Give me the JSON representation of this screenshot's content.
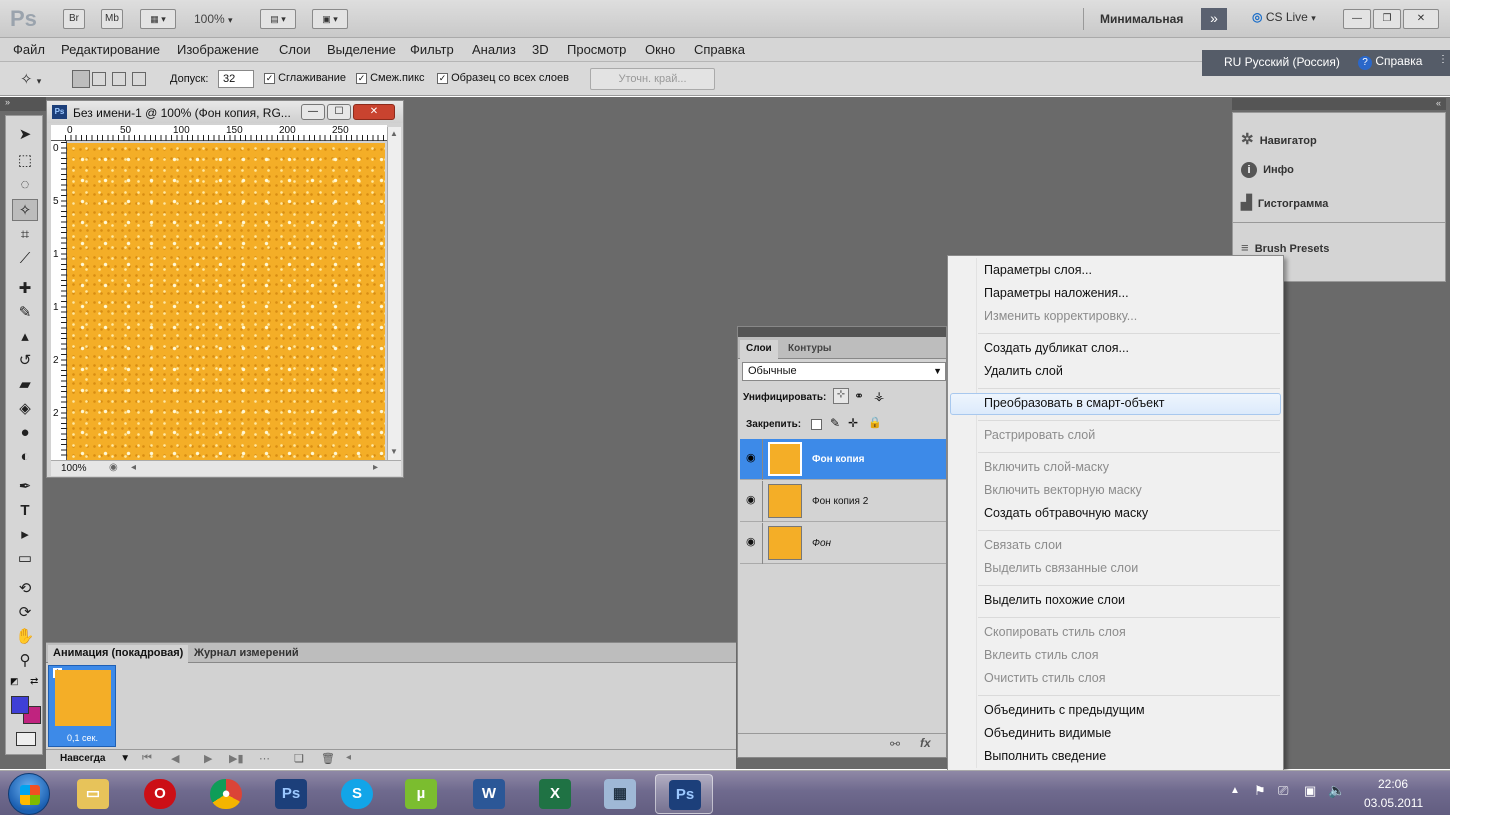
{
  "appbar": {
    "logo": "Ps",
    "br": "Br",
    "mb": "Mb",
    "zoom": "100%",
    "workspace": "Минимальная",
    "cslive": "CS Live"
  },
  "menu": [
    "Файл",
    "Редактирование",
    "Изображение",
    "Слои",
    "Выделение",
    "Фильтр",
    "Анализ",
    "3D",
    "Просмотр",
    "Окно",
    "Справка"
  ],
  "options": {
    "tolerance_label": "Допуск:",
    "tolerance_value": "32",
    "antialias": "Сглаживание",
    "contiguous": "Смеж.пикс",
    "sample_all": "Образец со всех слоев",
    "refine": "Уточн. край..."
  },
  "langbar": {
    "lang": "RU Русский (Россия)",
    "help": "Справка"
  },
  "document": {
    "title": "Без имени-1 @ 100% (Фон копия, RG...",
    "zoom": "100%",
    "ruler_h": [
      "0",
      "50",
      "100",
      "150",
      "200",
      "250"
    ],
    "ruler_v": [
      "0",
      "5",
      "1",
      "1",
      "2",
      "2"
    ]
  },
  "right_panel": {
    "items": [
      "Навигатор",
      "Инфо",
      "Гистограмма",
      "Brush Presets"
    ]
  },
  "layers_panel": {
    "tabs": [
      "Слои",
      "Контуры"
    ],
    "blend": "Обычные",
    "unify": "Унифицировать:",
    "lock": "Закрепить:",
    "layers": [
      "Фон копия",
      "Фон копия 2",
      "Фон"
    ],
    "selected": 0
  },
  "context_menu": {
    "items": [
      {
        "label": "Параметры слоя...",
        "disabled": false
      },
      {
        "label": "Параметры наложения...",
        "disabled": false
      },
      {
        "label": "Изменить корректировку...",
        "disabled": true
      },
      {
        "label": "Создать дубликат слоя...",
        "disabled": false
      },
      {
        "label": "Удалить слой",
        "disabled": false
      },
      {
        "label": "Преобразовать в смарт-объект",
        "disabled": false,
        "highlight": true
      },
      {
        "label": "Растрировать слой",
        "disabled": true
      },
      {
        "label": "Включить слой-маску",
        "disabled": true
      },
      {
        "label": "Включить векторную маску",
        "disabled": true
      },
      {
        "label": "Создать обтравочную маску",
        "disabled": false
      },
      {
        "label": "Связать слои",
        "disabled": true
      },
      {
        "label": "Выделить связанные слои",
        "disabled": true
      },
      {
        "label": "Выделить похожие слои",
        "disabled": false
      },
      {
        "label": "Скопировать стиль слоя",
        "disabled": true
      },
      {
        "label": "Вклеить стиль слоя",
        "disabled": true
      },
      {
        "label": "Очистить стиль слоя",
        "disabled": true
      },
      {
        "label": "Объединить с предыдущим",
        "disabled": false
      },
      {
        "label": "Объединить видимые",
        "disabled": false
      },
      {
        "label": "Выполнить сведение",
        "disabled": false
      }
    ]
  },
  "animation": {
    "tabs": [
      "Анимация (покадровая)",
      "Журнал измерений"
    ],
    "frame_number": "1",
    "frame_delay": "0,1 сек.",
    "loop": "Навсегда"
  },
  "taskbar": {
    "apps": [
      "start",
      "explorer",
      "opera",
      "chrome",
      "photoshop",
      "skype",
      "utorrent",
      "word",
      "excel",
      "calculator",
      "photoshop-active"
    ],
    "time": "22:06",
    "date": "03.05.2011"
  },
  "colors": {
    "foreground": "#3f3fd6",
    "background": "#c0237f",
    "canvas": "#f4ae27",
    "selection": "#3d8ae8"
  }
}
